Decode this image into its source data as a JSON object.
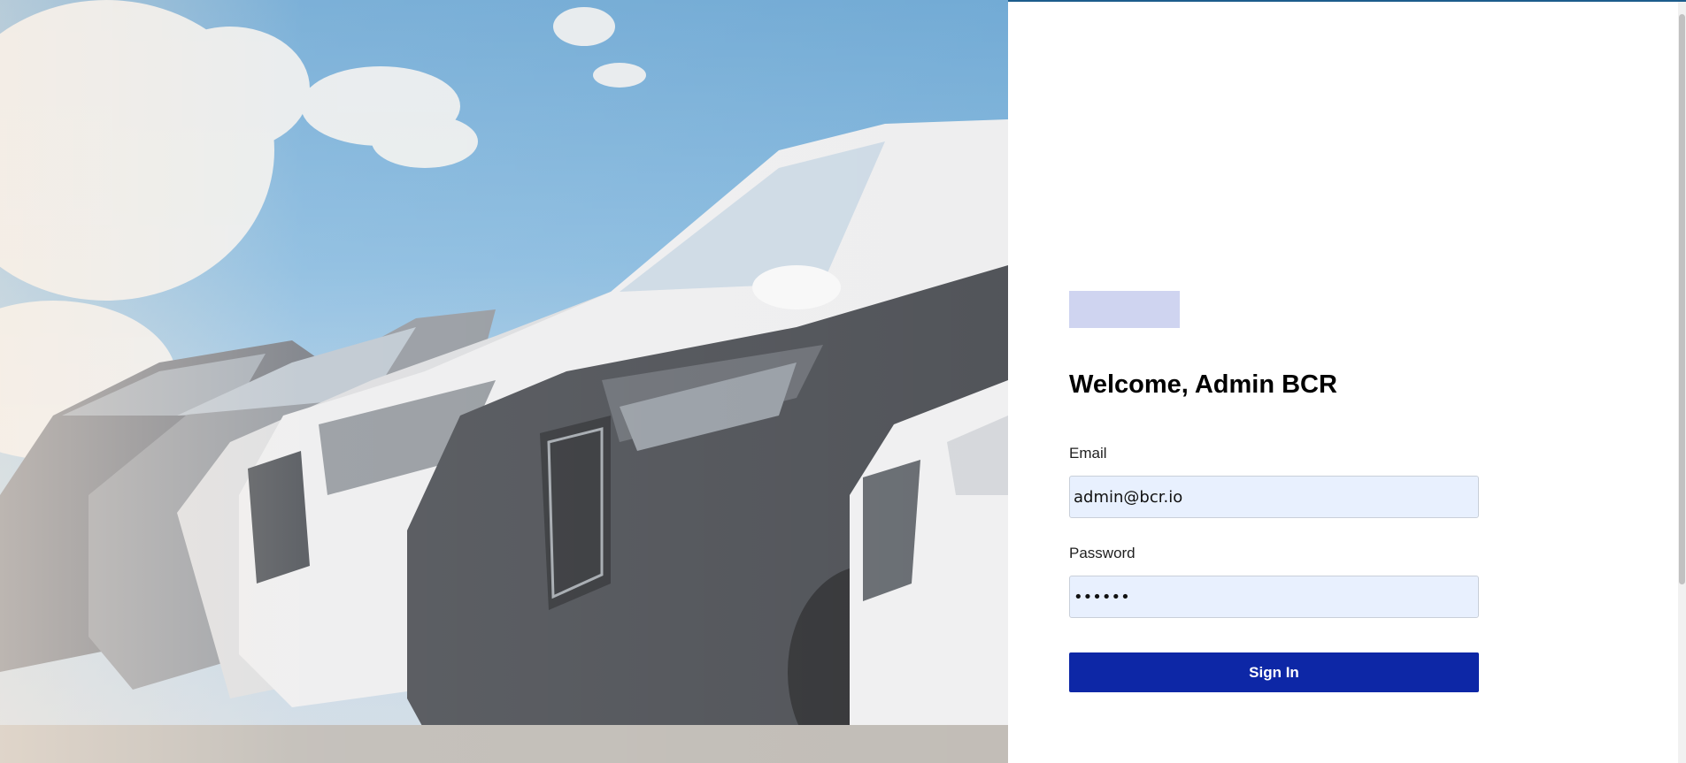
{
  "login": {
    "title": "Welcome, Admin BCR",
    "email_label": "Email",
    "email_value": "admin@bcr.io",
    "password_label": "Password",
    "password_value": "••••••",
    "signin_label": "Sign In"
  },
  "hero": {
    "alt": "Row of parked cars under a blue sky"
  },
  "colors": {
    "accent": "#0d27a6",
    "input_bg": "#e8f0fe",
    "logo_placeholder": "#cfd4f0"
  }
}
